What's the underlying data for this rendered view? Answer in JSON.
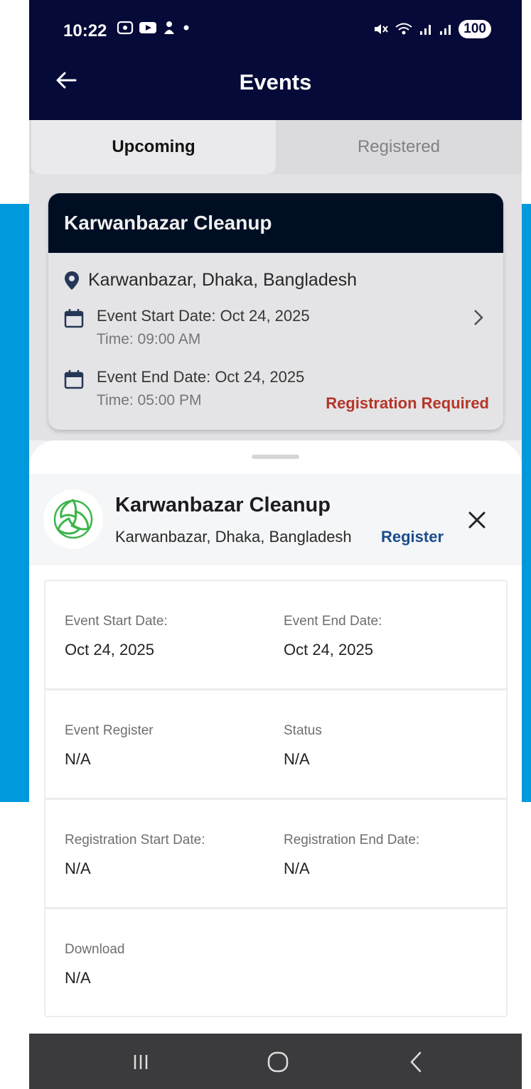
{
  "status_bar": {
    "time": "10:22",
    "battery": "100"
  },
  "app_bar": {
    "title": "Events"
  },
  "tabs": [
    {
      "label": "Upcoming",
      "active": true
    },
    {
      "label": "Registered",
      "active": false
    }
  ],
  "event_card": {
    "title": "Karwanbazar Cleanup",
    "location": "Karwanbazar, Dhaka, Bangladesh",
    "start_date_text": "Event Start Date: Oct 24, 2025",
    "start_time_text": "Time: 09:00 AM",
    "end_date_text": "Event End Date: Oct 24, 2025",
    "end_time_text": "Time: 05:00 PM",
    "badge": "Registration Required"
  },
  "sheet": {
    "title": "Karwanbazar Cleanup",
    "location": "Karwanbazar, Dhaka, Bangladesh",
    "register_label": "Register",
    "rows": [
      [
        {
          "label": "Event Start Date:",
          "value": "Oct 24, 2025"
        },
        {
          "label": "Event End Date:",
          "value": "Oct 24, 2025"
        }
      ],
      [
        {
          "label": "Event Register",
          "value": "N/A"
        },
        {
          "label": "Status",
          "value": "N/A"
        }
      ],
      [
        {
          "label": "Registration Start Date:",
          "value": "N/A"
        },
        {
          "label": "Registration End Date:",
          "value": "N/A"
        }
      ],
      [
        {
          "label": "Download",
          "value": "N/A"
        }
      ]
    ]
  },
  "colors": {
    "app_bar": "#060a38",
    "card_header": "#010f26",
    "accent_link": "#1a4d8f",
    "warning": "#c0392b",
    "backdrop_blue": "#0099db"
  },
  "icons": [
    "back-arrow-icon",
    "location-pin-icon",
    "calendar-icon",
    "chevron-right-icon",
    "close-icon",
    "recycle-logo-icon",
    "nav-recents-icon",
    "nav-home-icon",
    "nav-back-icon"
  ]
}
